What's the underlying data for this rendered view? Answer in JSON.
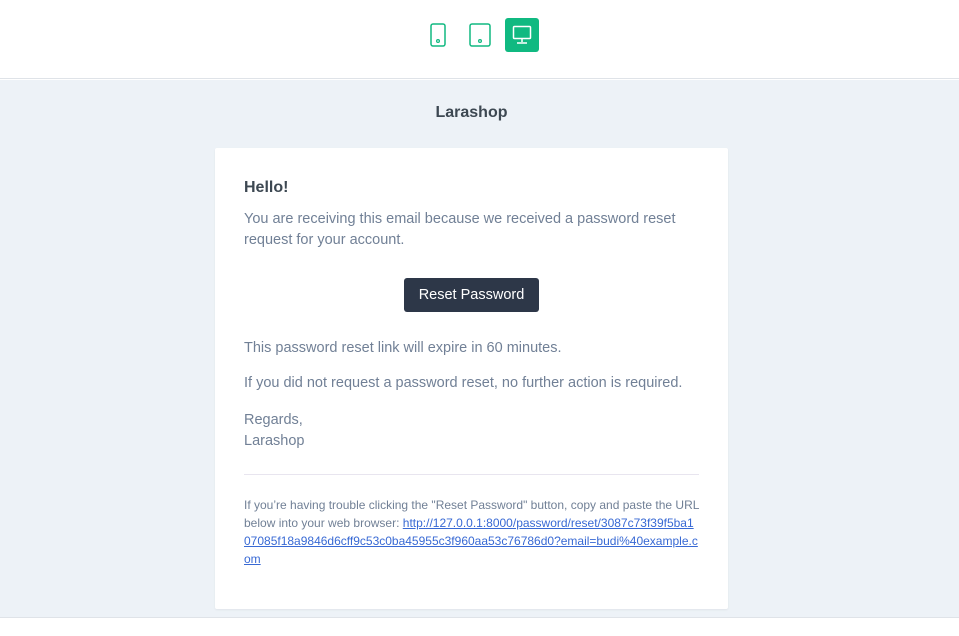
{
  "devices": [
    {
      "name": "phone",
      "icon": "phone-icon",
      "active": false
    },
    {
      "name": "tablet",
      "icon": "tablet-icon",
      "active": false
    },
    {
      "name": "desktop",
      "icon": "monitor-icon",
      "active": true
    }
  ],
  "colors": {
    "accent": "#10b981",
    "button": "#2d3748",
    "link": "#3869d4",
    "background": "#edf2f7"
  },
  "email": {
    "brand": "Larashop",
    "greeting": "Hello!",
    "intro": "You are receiving this email because we received a password reset request for your account.",
    "button_label": "Reset Password",
    "expire_text": "This password reset link will expire in 60 minutes.",
    "no_action_text": "If you did not request a password reset, no further action is required.",
    "regards": "Regards,",
    "signature": "Larashop",
    "subcopy_text": "If you’re having trouble clicking the \"Reset Password\" button, copy and paste the URL below into your web browser:",
    "reset_url": "http://127.0.0.1:8000/password/reset/3087c73f39f5ba107085f18a9846d6cff9c53c0ba45955c3f960aa53c76786d0?email=budi%40example.com"
  }
}
